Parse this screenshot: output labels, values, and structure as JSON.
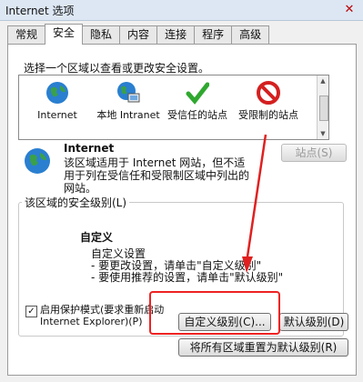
{
  "window": {
    "title": "Internet 选项",
    "close_glyph": "✕"
  },
  "tabs": [
    "常规",
    "安全",
    "隐私",
    "内容",
    "连接",
    "程序",
    "高级"
  ],
  "instruction": "选择一个区域以查看或更改安全设置。",
  "zones": [
    {
      "label": "Internet",
      "icon": "globe-icon"
    },
    {
      "label": "本地 Intranet",
      "icon": "intranet-icon"
    },
    {
      "label": "受信任的站点",
      "icon": "checkmark-icon"
    },
    {
      "label": "受限制的站点",
      "icon": "restricted-icon"
    }
  ],
  "zone_info": {
    "name": "Internet",
    "description": "该区域适用于 Internet 网站，但不适用于列在受信任和受限制区域中列出的网站。",
    "sites_button": "站点(S)"
  },
  "security_level": {
    "legend": "该区域的安全级别(L)",
    "heading": "自定义",
    "line1": "自定义设置",
    "line2": "- 要更改设置，请单击\"自定义级别\"",
    "line3": "- 要使用推荐的设置，请单击\"默认级别\""
  },
  "protected_mode": {
    "checked": true,
    "label": "启用保护模式(要求重新启动 Internet Explorer)(P)"
  },
  "buttons": {
    "custom_level": "自定义级别(C)...",
    "default_level": "默认级别(D)",
    "reset_all": "将所有区域重置为默认级别(R)"
  },
  "colors": {
    "annotation": "#e02020"
  }
}
